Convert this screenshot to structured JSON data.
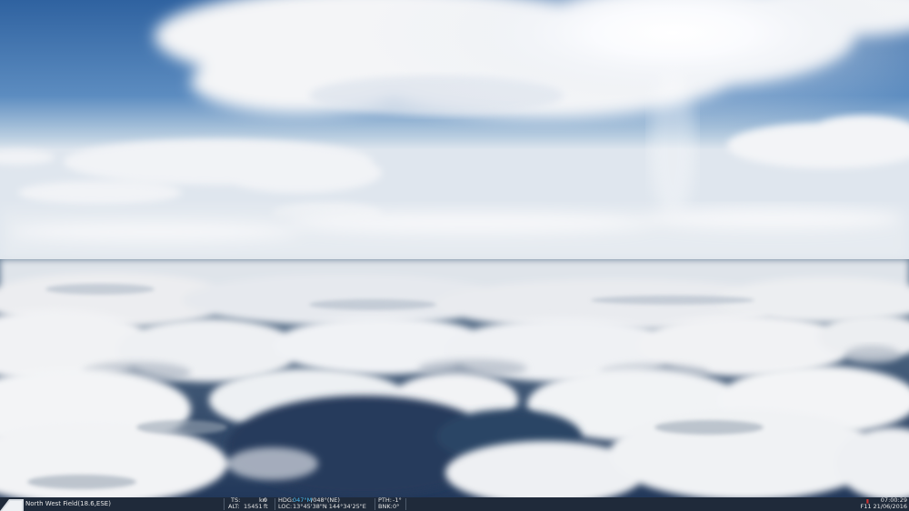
{
  "scene": {
    "description_icon": "sky-clouds-scene",
    "sky_color": "#3d6fa8",
    "cloud_color": "#f2f2f2",
    "ocean_color": "#27405d"
  },
  "hud": {
    "location": "North West Field(18.6,ESE)",
    "ts_label": "TS:",
    "ts_value": "0",
    "ts_unit": "kn",
    "alt_label": "ALT:",
    "alt_value": "15451",
    "alt_unit": "ft",
    "hdg_label": "HDG:",
    "hdg_true": "047°M",
    "hdg_rest": "/048°(NE)",
    "loc_label": "LOC:",
    "loc_value": "13°45'38\"N 144°34'25\"E",
    "pth_label": "PTH:",
    "pth_value": "-1°",
    "bnk_label": "BNK:",
    "bnk_value": "0°",
    "time": "07:00:29",
    "date": "F11 21/06/2016",
    "accent_color": "#4cc3ff"
  }
}
